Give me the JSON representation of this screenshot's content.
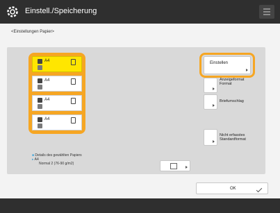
{
  "header": {
    "title": "Einstell./Speicherung",
    "gear_icon": "gear-icon",
    "menu_icon": "menu-icon"
  },
  "subtitle": "<Einstellungen Papier>",
  "paper_sources": [
    {
      "size": "A4",
      "selected": true
    },
    {
      "size": "A4",
      "selected": false
    },
    {
      "size": "A4",
      "selected": false
    },
    {
      "size": "A4",
      "selected": false
    }
  ],
  "buttons": {
    "einstellen": "Einstellen",
    "anzeigeformat": "Anzeigeformat\nFormat",
    "briefumschlag": "Briefumschlag",
    "nicht_erfasstes": "Nicht erfasstes\nStandardformat",
    "ok": "OK"
  },
  "details": {
    "heading": "Details des gewählten Papiers",
    "size": "A4",
    "type": "Normal 2 (76-90 g/m2)"
  },
  "colors": {
    "highlight": "#f6a623",
    "selected_paper": "#ffe600",
    "header_bg": "#2f2f2f"
  }
}
